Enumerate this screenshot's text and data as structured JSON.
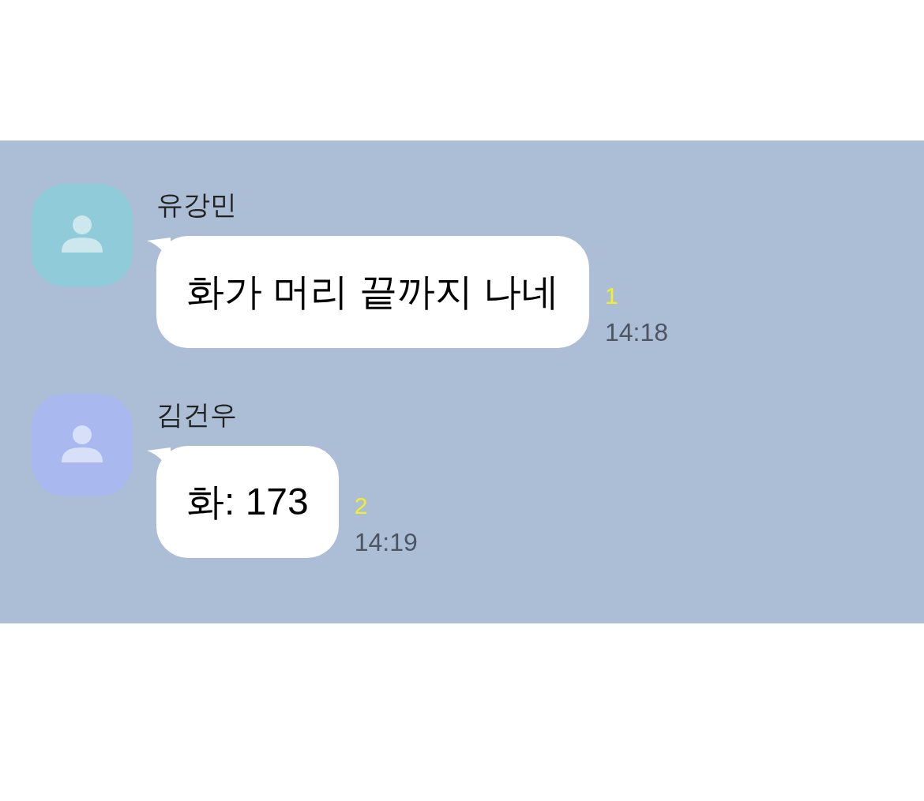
{
  "messages": [
    {
      "sender": "유강민",
      "color": "#8fcbd9",
      "text": "화가 머리 끝까지 나네",
      "unread": "1",
      "time": "14:18"
    },
    {
      "sender": "김건우",
      "color": "#a9b9ef",
      "text": "화: 173",
      "unread": "2",
      "time": "14:19"
    }
  ]
}
